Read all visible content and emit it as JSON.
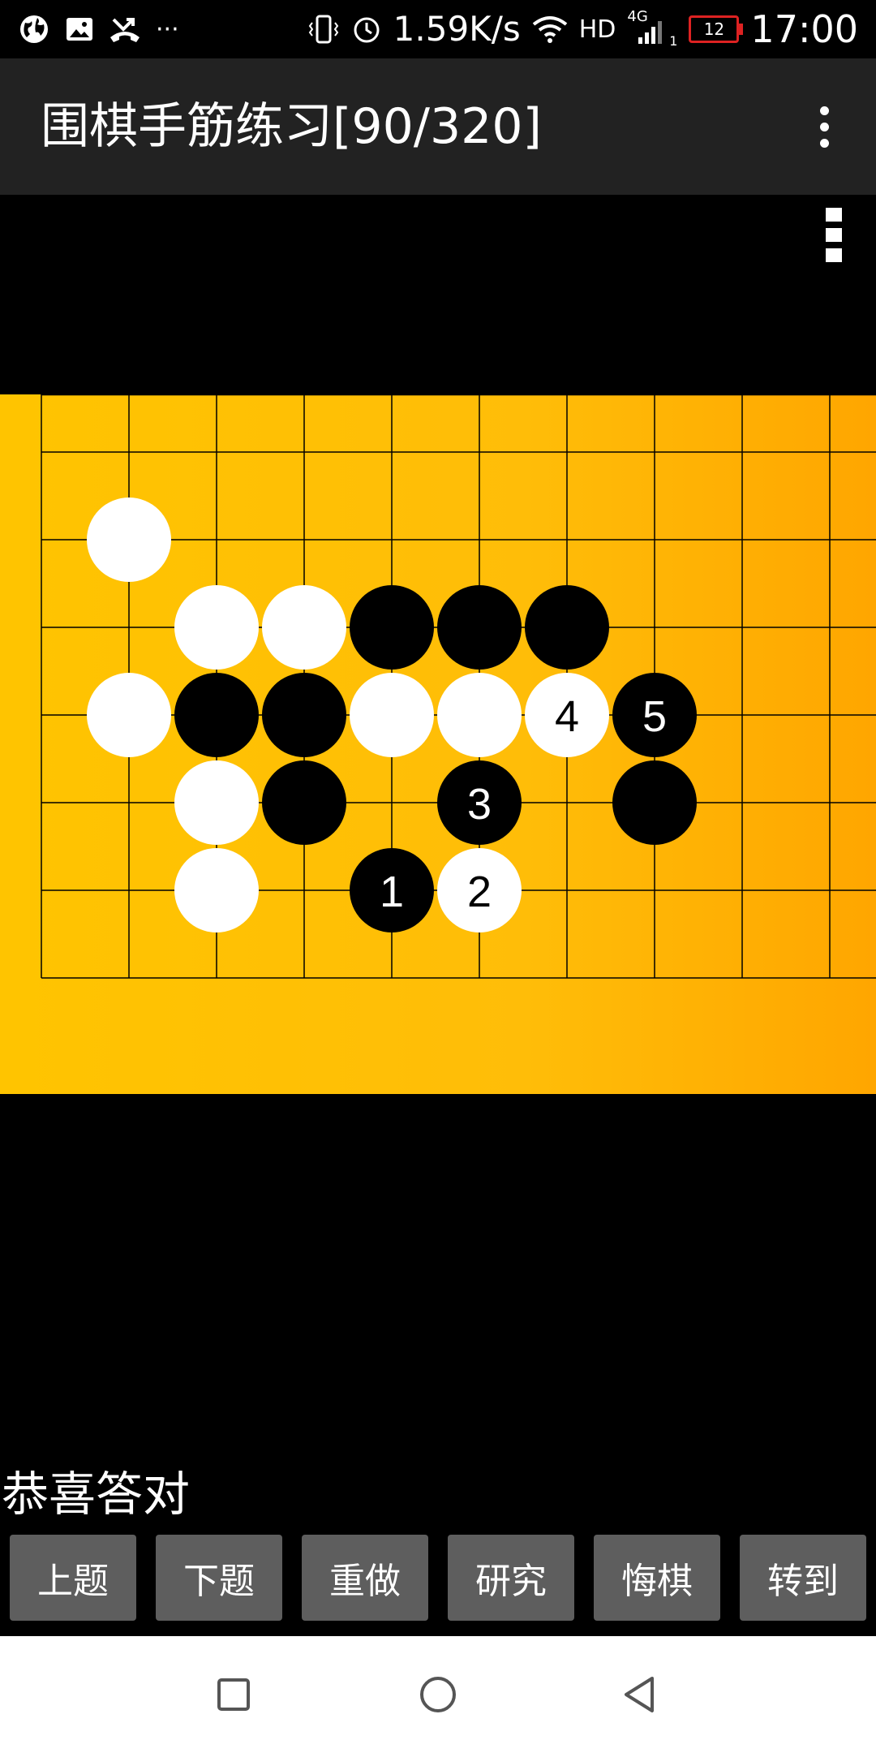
{
  "status_bar": {
    "network_speed": "1.59K/s",
    "hd_label": "HD",
    "net_type": "4G",
    "sim_slot": "1",
    "battery_level": "12",
    "time": "17:00",
    "left_icons": [
      "globe-icon",
      "image-icon",
      "missed-call-icon",
      "more-notifications-icon"
    ],
    "more_label": "···"
  },
  "app_bar": {
    "title": "围棋手筋练习[90/320]"
  },
  "board": {
    "white_stones": [
      {
        "col": 1,
        "row": 1
      },
      {
        "col": 2,
        "row": 2
      },
      {
        "col": 3,
        "row": 2
      },
      {
        "col": 1,
        "row": 3
      },
      {
        "col": 4,
        "row": 3
      },
      {
        "col": 5,
        "row": 3
      },
      {
        "col": 6,
        "row": 3,
        "label": "4"
      },
      {
        "col": 2,
        "row": 4
      },
      {
        "col": 2,
        "row": 5
      },
      {
        "col": 5,
        "row": 5,
        "label": "2"
      }
    ],
    "black_stones": [
      {
        "col": 4,
        "row": 2
      },
      {
        "col": 5,
        "row": 2
      },
      {
        "col": 6,
        "row": 2
      },
      {
        "col": 2,
        "row": 3
      },
      {
        "col": 3,
        "row": 3
      },
      {
        "col": 7,
        "row": 3,
        "label": "5"
      },
      {
        "col": 3,
        "row": 4
      },
      {
        "col": 5,
        "row": 4,
        "label": "3"
      },
      {
        "col": 7,
        "row": 4
      },
      {
        "col": 4,
        "row": 5,
        "label": "1"
      }
    ]
  },
  "result_text": "恭喜答对",
  "buttons": [
    {
      "name": "prev-problem-button",
      "label": "上题"
    },
    {
      "name": "next-problem-button",
      "label": "下题"
    },
    {
      "name": "redo-button",
      "label": "重做"
    },
    {
      "name": "research-button",
      "label": "研究"
    },
    {
      "name": "undo-button",
      "label": "悔棋"
    },
    {
      "name": "goto-button",
      "label": "转到"
    }
  ],
  "nav_bar": [
    "recent-apps-icon",
    "home-icon",
    "back-icon"
  ]
}
